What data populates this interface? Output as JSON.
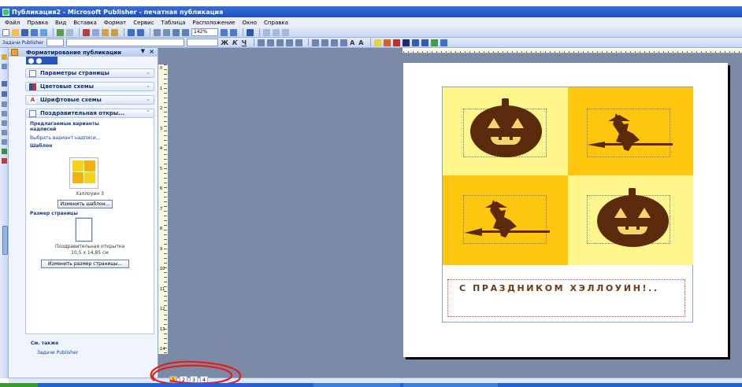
{
  "window": {
    "title": "Публикация2 - Microsoft Publisher - печатная публикация"
  },
  "menu": [
    "Файл",
    "Правка",
    "Вид",
    "Вставка",
    "Формат",
    "Сервис",
    "Таблица",
    "Расположение",
    "Окно",
    "Справка"
  ],
  "toolbar": {
    "zoom": "142%",
    "tasks_label": "Задачи Publisher"
  },
  "taskpane": {
    "title": "Форматирование публикации",
    "sections": [
      "Параметры страницы",
      "Цветовые схемы",
      "Шрифтовые схемы",
      "Поздравительная откры..."
    ],
    "suggested_heading": "Предлагаемые варианты надписей",
    "choose_link": "Выбрать вариант надписи...",
    "template_heading": "Шаблон",
    "template_name": "Хэллоуин 3",
    "change_template_btn": "Изменить шаблон...",
    "page_size_heading": "Размер страницы",
    "page_size_name": "Поздравительная открытка",
    "page_size_dims": "10,5 x 14,85 см",
    "change_size_btn": "Изменить размер страницы...",
    "see_also": "См. также",
    "see_also_link": "Задачи Publisher"
  },
  "ruler": {
    "vertical_numbers": [
      "0",
      "1",
      "2",
      "3",
      "4",
      "5",
      "6",
      "7",
      "8",
      "9",
      "10",
      "11",
      "12",
      "13",
      "14"
    ]
  },
  "card": {
    "greeting": "С ПРАЗДНИКОМ ХЭЛЛОУИН!.."
  },
  "colors": {
    "light_yellow": "#fff68c",
    "orange": "#ffc60f",
    "brown": "#5a2a0b"
  },
  "pages": [
    "1",
    "2",
    "3",
    "4"
  ]
}
